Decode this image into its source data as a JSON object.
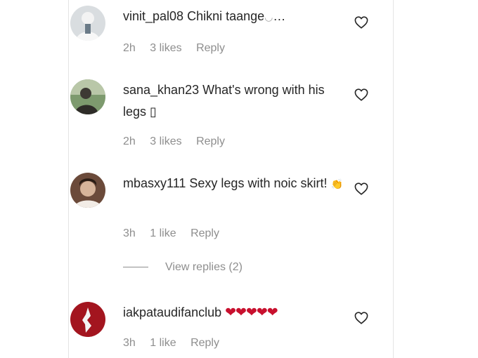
{
  "comments": [
    {
      "username": "vinit_pal08",
      "text": "Chikni taange",
      "trailing": "…",
      "time": "2h",
      "likes": "3 likes",
      "reply": "Reply",
      "avatar": "avatar-person-white"
    },
    {
      "username": "sana_khan23",
      "text": "What's wrong with his legs ",
      "trailing": "▯",
      "time": "2h",
      "likes": "3 likes",
      "reply": "Reply",
      "avatar": "avatar-person-green"
    },
    {
      "username": "mbasxy111",
      "text": "Sexy legs with noic skirt!",
      "trailing": "👏",
      "time": "3h",
      "likes": "1 like",
      "reply": "Reply",
      "avatar": "avatar-person-brown"
    },
    {
      "username": "iakpataudifanclub",
      "text": "",
      "trailing": "❤❤❤❤❤",
      "time": "3h",
      "likes": "1 like",
      "reply": "Reply",
      "avatar": "avatar-logo-red"
    }
  ],
  "view_replies": {
    "label": "View replies (2)"
  },
  "icons": {
    "like": "heart-outline-icon"
  },
  "colors": {
    "text": "#262626",
    "meta": "#8e8e8e",
    "hearts": "#c8102e"
  }
}
